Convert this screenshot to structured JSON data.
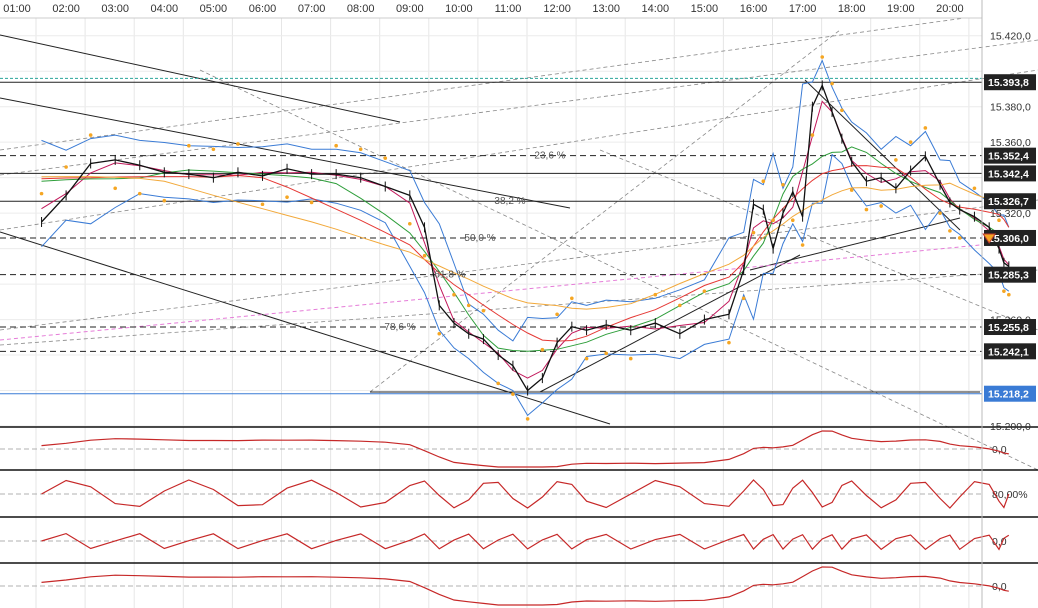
{
  "chart_data": {
    "type": "line",
    "x_labels": [
      "01:00",
      "02:00",
      "03:00",
      "04:00",
      "05:00",
      "06:00",
      "07:00",
      "08:00",
      "09:00",
      "10:00",
      "11:00",
      "12:00",
      "13:00",
      "14:00",
      "15:00",
      "16:00",
      "17:00",
      "18:00",
      "19:00",
      "20:00"
    ],
    "y_ticks": [
      "15.420,0",
      "15.380,0",
      "15.360,0",
      "15.320,0",
      "15.260,0",
      "15.200,0"
    ],
    "ylim": [
      15200,
      15430
    ],
    "price_series": {
      "times": [
        0.5,
        1,
        1.5,
        2,
        2.5,
        3,
        3.5,
        4,
        4.5,
        5,
        5.5,
        6,
        6.5,
        7,
        7.5,
        8,
        8.3,
        8.6,
        8.9,
        9.2,
        9.5,
        9.8,
        10.1,
        10.4,
        10.7,
        11,
        11.3,
        11.6,
        12,
        12.5,
        13,
        13.5,
        14,
        14.5,
        14.8,
        15,
        15.2,
        15.4,
        15.6,
        15.8,
        16,
        16.2,
        16.4,
        16.6,
        16.8,
        17,
        17.3,
        17.6,
        17.9,
        18.2,
        18.5,
        18.8,
        19,
        19.2,
        19.5,
        19.8,
        20,
        20.1,
        20.2
      ],
      "values": [
        15315,
        15330,
        15348,
        15350,
        15347,
        15343,
        15342,
        15340,
        15343,
        15341,
        15345,
        15342,
        15342,
        15340,
        15335,
        15330,
        15312,
        15268,
        15258,
        15252,
        15249,
        15240,
        15234,
        15220,
        15227,
        15247,
        15256,
        15254,
        15257,
        15254,
        15258,
        15252,
        15260,
        15263,
        15288,
        15325,
        15322,
        15300,
        15320,
        15332,
        15318,
        15380,
        15392,
        15377,
        15362,
        15349,
        15338,
        15340,
        15334,
        15344,
        15352,
        15336,
        15326,
        15322,
        15318,
        15312,
        15300,
        15292,
        15290
      ]
    },
    "horizontal_levels": [
      {
        "label": "15.393,8",
        "value": 15393.8,
        "style": "solid",
        "color": "#222222"
      },
      {
        "label": "15.352,4",
        "value": 15352.4,
        "style": "dashed",
        "color": "#222222"
      },
      {
        "label": "15.342,4",
        "value": 15342.4,
        "style": "solid",
        "color": "#222222"
      },
      {
        "label": "15.326,7",
        "value": 15326.7,
        "style": "solid",
        "color": "#222222"
      },
      {
        "label": "15.306,0",
        "value": 15306.0,
        "style": "dashed",
        "color": "#222222"
      },
      {
        "label": "15.285,3",
        "value": 15285.3,
        "style": "dashed",
        "color": "#222222"
      },
      {
        "label": "15.255,8",
        "value": 15255.8,
        "style": "dashed",
        "color": "#222222"
      },
      {
        "label": "15.242,1",
        "value": 15242.1,
        "style": "dashed",
        "color": "#222222"
      },
      {
        "label": "15.218,2",
        "value": 15218.2,
        "style": "solid",
        "color": "#3a7bd5"
      }
    ],
    "fibonacci_labels": [
      "23,6 %",
      "38,2 %",
      "50,0 %",
      "61,8 %",
      "78,6 %"
    ],
    "fibonacci_values": [
      15352.4,
      15326.7,
      15306.0,
      15285.3,
      15255.8
    ],
    "sub_panels": [
      {
        "id": "macd",
        "right_label": "0,0"
      },
      {
        "id": "stochastic",
        "right_label": "80,00%"
      },
      {
        "id": "momentum",
        "right_label": "0,0"
      },
      {
        "id": "oscillator",
        "right_label": "0,0"
      }
    ],
    "colors": {
      "price": "#111111",
      "bollinger": "#3a7bd5",
      "ma_fast": "#c2185b",
      "ma_mid": "#2e9e3a",
      "ma_slow": "#e53935",
      "ma_long": "#f2a93b",
      "sar": "#f5a623",
      "tag_bg": "#222222",
      "tag_blue": "#3a7bd5",
      "trend_dashed": "#888888",
      "long_ma_pink": "#e57cd8"
    }
  }
}
